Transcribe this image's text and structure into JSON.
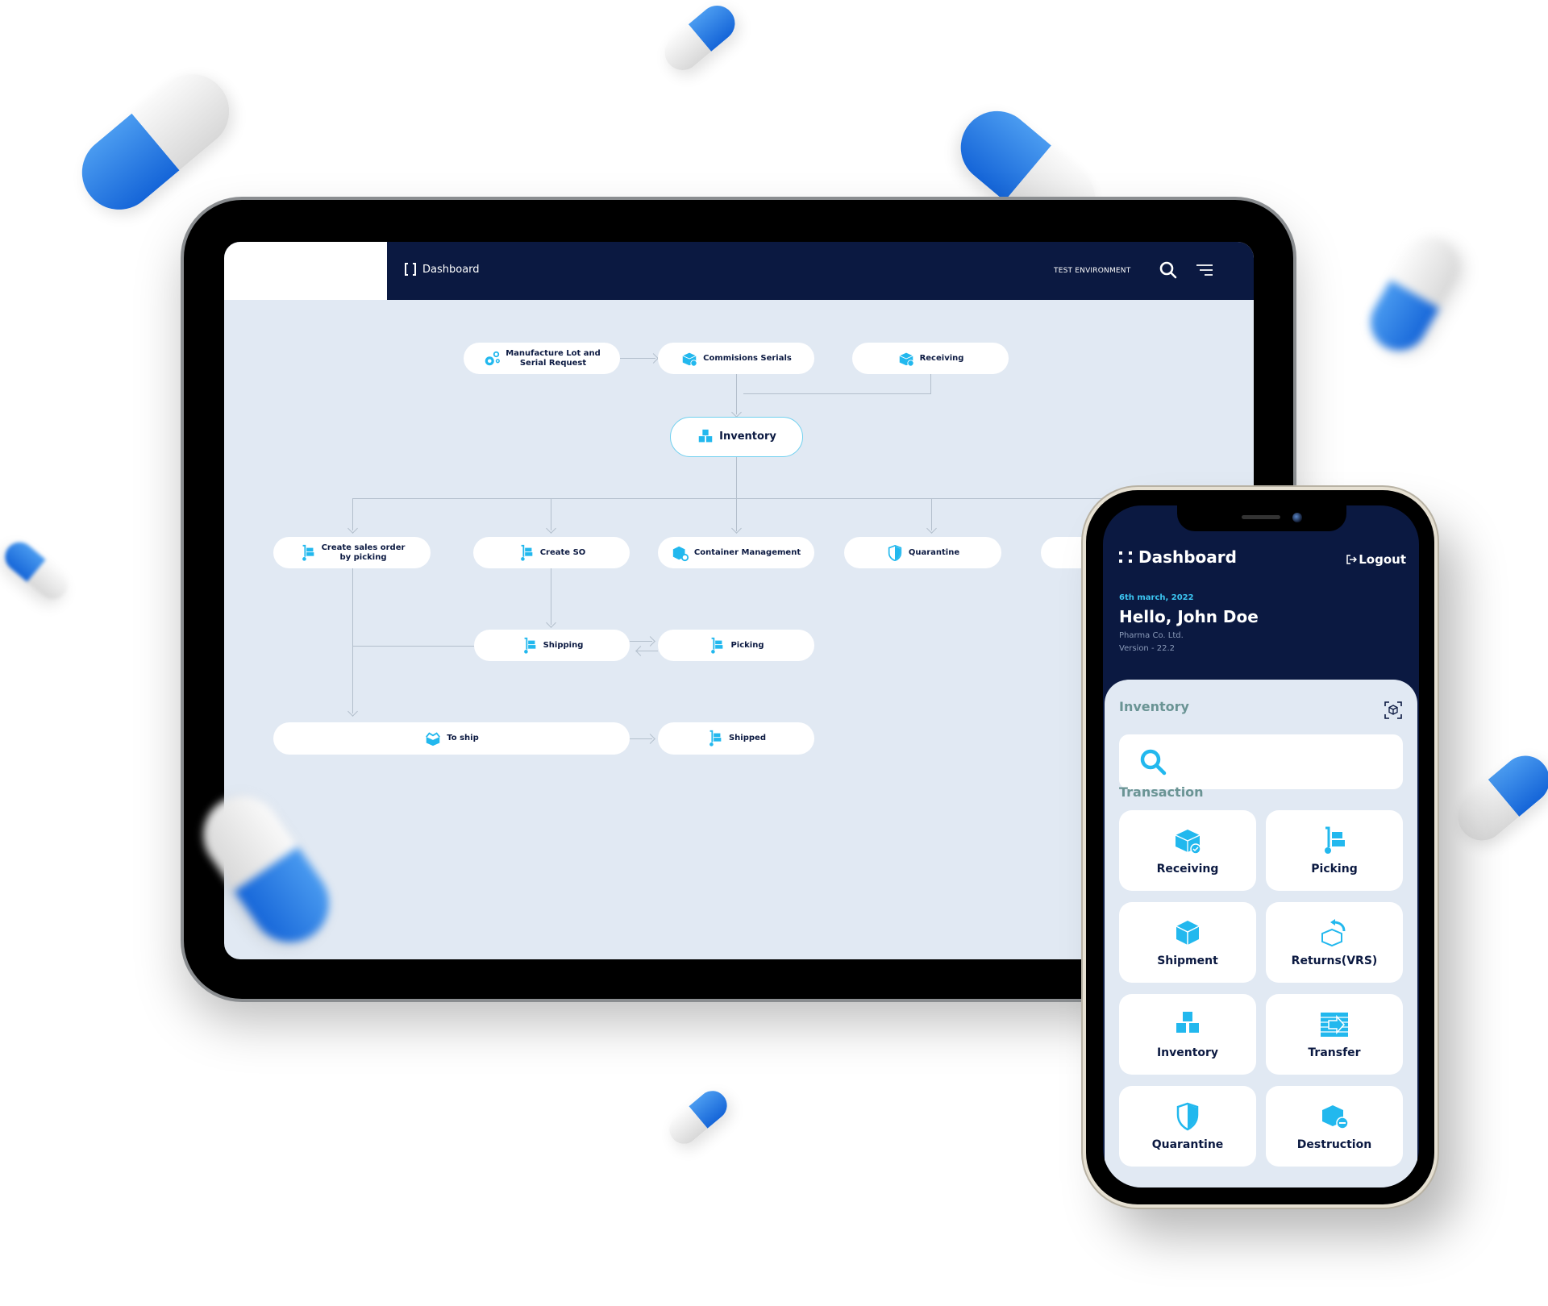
{
  "tablet": {
    "header": {
      "title": "Dashboard",
      "environment": "TEST ENVIRONMENT",
      "search_icon": "search-icon",
      "menu_icon": "menu-icon"
    },
    "flow": {
      "nodes": [
        {
          "id": "manufacture",
          "label_line1": "Manufacture Lot and",
          "label_line2": "Serial Request",
          "icon": "gears-icon"
        },
        {
          "id": "commissions",
          "label": "Commisions Serials",
          "icon": "box-check-icon"
        },
        {
          "id": "receiving",
          "label": "Receiving",
          "icon": "box-check-icon"
        },
        {
          "id": "inventory",
          "label": "Inventory",
          "icon": "boxes-icon"
        },
        {
          "id": "create-sales",
          "label_line1": "Create sales order",
          "label_line2": "by picking",
          "icon": "hand-truck-icon"
        },
        {
          "id": "create-so",
          "label": "Create SO",
          "icon": "hand-truck-icon"
        },
        {
          "id": "container",
          "label": "Container Management",
          "icon": "container-gear-icon"
        },
        {
          "id": "quarantine",
          "label": "Quarantine",
          "icon": "shield-icon"
        },
        {
          "id": "shipping",
          "label": "Shipping",
          "icon": "hand-truck-icon"
        },
        {
          "id": "picking",
          "label": "Picking",
          "icon": "hand-truck-icon"
        },
        {
          "id": "to-ship",
          "label": "To ship",
          "icon": "open-box-icon"
        },
        {
          "id": "shipped",
          "label": "Shipped",
          "icon": "hand-truck-icon"
        }
      ]
    }
  },
  "phone": {
    "header": {
      "title": "Dashboard",
      "logout_label": "Logout",
      "date": "6th march, 2022",
      "greeting": "Hello, John Doe",
      "company": "Pharma Co. Ltd.",
      "version": "Version - 22.2"
    },
    "inventory_label": "Inventory",
    "search_placeholder": "",
    "transaction_label": "Transaction",
    "tiles": [
      {
        "label": "Receiving",
        "icon": "box-check-icon"
      },
      {
        "label": "Picking",
        "icon": "hand-truck-icon"
      },
      {
        "label": "Shipment",
        "icon": "box-icon"
      },
      {
        "label": "Returns(VRS)",
        "icon": "box-return-icon"
      },
      {
        "label": "Inventory",
        "icon": "boxes-icon"
      },
      {
        "label": "Transfer",
        "icon": "transfer-icon"
      },
      {
        "label": "Quarantine",
        "icon": "shield-icon"
      },
      {
        "label": "Destruction",
        "icon": "box-minus-icon"
      }
    ]
  },
  "colors": {
    "navy": "#0b1941",
    "accent": "#3cc6f2",
    "background": "#e1e9f3",
    "muted_teal": "#6a9494",
    "pill_blue": "#1e74e0"
  }
}
